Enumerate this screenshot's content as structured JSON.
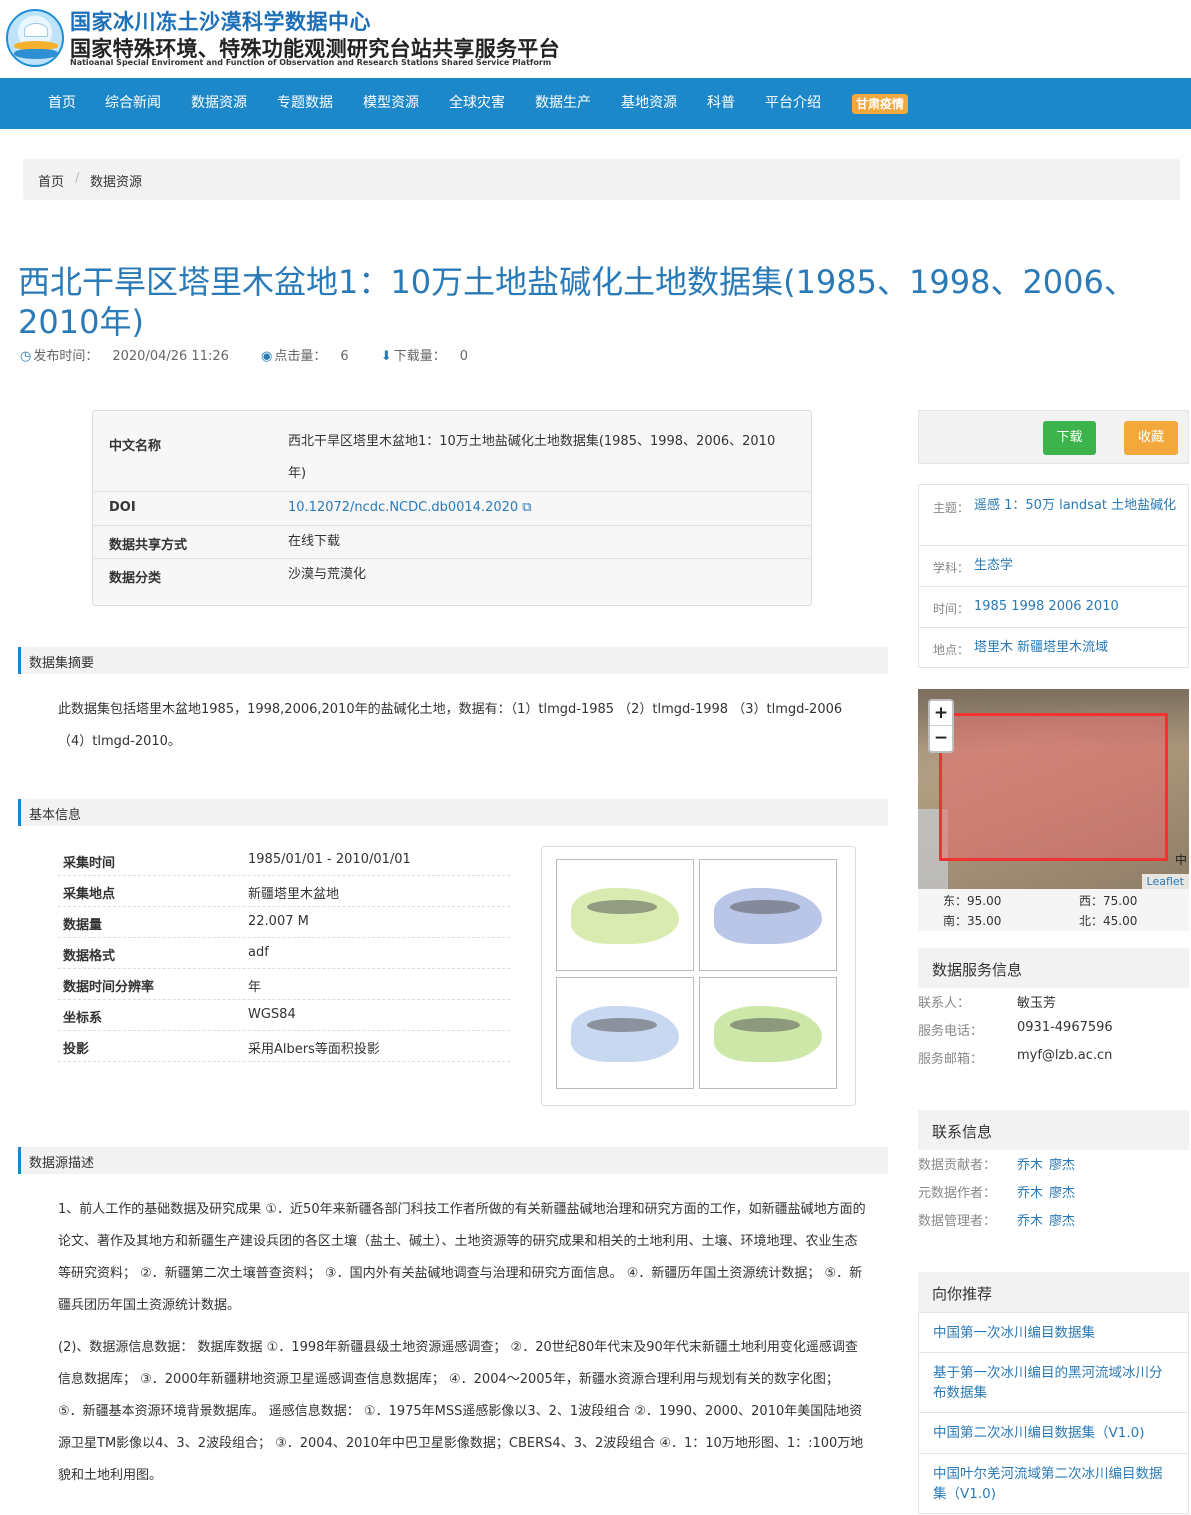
{
  "site": {
    "title_cn": "国家冰川冻土沙漠科学数据中心",
    "subtitle_cn": "国家特殊环境、特殊功能观测研究台站共享服务平台",
    "subtitle_en": "Natioanal Special Enviroment and Function of Observation and Research Stations Shared Service Platform"
  },
  "nav": {
    "items": [
      "首页",
      "综合新闻",
      "数据资源",
      "专题数据",
      "模型资源",
      "全球灾害",
      "数据生产",
      "基地资源",
      "科普",
      "平台介绍"
    ],
    "badge": "甘肃疫情"
  },
  "breadcrumb": {
    "home": "首页",
    "sep": "/",
    "current": "数据资源"
  },
  "dataset": {
    "title": "西北干旱区塔里木盆地1：10万土地盐碱化土地数据集(1985、1998、2006、2010年)",
    "publish_label": "发布时间：",
    "publish_time": "2020/04/26 11:26",
    "views_label": "点击量：",
    "views": "6",
    "downloads_label": "下载量：",
    "downloads": "0"
  },
  "info_box": {
    "rows": [
      {
        "label": "中文名称",
        "value": "西北干旱区塔里木盆地1：10万土地盐碱化土地数据集(1985、1998、2006、2010年)"
      },
      {
        "label": "DOI",
        "value": "10.12072/ncdc.NCDC.db0014.2020"
      },
      {
        "label": "数据共享方式",
        "value": "在线下载"
      },
      {
        "label": "数据分类",
        "value": "沙漠与荒漠化"
      }
    ]
  },
  "abstract": {
    "heading": "数据集摘要",
    "text": "此数据集包括塔里木盆地1985，1998,2006,2010年的盐碱化土地，数据有：（1）tlmgd-1985 （2）tlmgd-1998 （3）tlmgd-2006 （4）tlmgd-2010。"
  },
  "basic_info": {
    "heading": "基本信息",
    "rows": [
      {
        "label": "采集时间",
        "value": "1985/01/01  -  2010/01/01"
      },
      {
        "label": "采集地点",
        "value": "新疆塔里木盆地"
      },
      {
        "label": "数据量",
        "value": "22.007 M"
      },
      {
        "label": "数据格式",
        "value": "adf"
      },
      {
        "label": "数据时间分辨率",
        "value": "年"
      },
      {
        "label": "坐标系",
        "value": "WGS84"
      },
      {
        "label": "投影",
        "value": "采用Albers等面积投影"
      }
    ]
  },
  "source": {
    "heading": "数据源描述",
    "p1": "1、前人工作的基础数据及研究成果 ①．近50年来新疆各部门科技工作者所做的有关新疆盐碱地治理和研究方面的工作，如新疆盐碱地方面的论文、著作及其地方和新疆生产建设兵团的各区土壤（盐土、碱土）、土地资源等的研究成果和相关的土地利用、土壤、环境地理、农业生态等研究资料；  ②．新疆第二次土壤普查资料；  ③．国内外有关盐碱地调查与治理和研究方面信息。 ④．新疆历年国土资源统计数据；  ⑤．新疆兵团历年国土资源统计数据。",
    "p2": "(2)、数据源信息数据： 数据库数据 ①．1998年新疆县级土地资源遥感调查；  ②．20世纪80年代末及90年代末新疆土地利用变化遥感调查信息数据库；  ③．2000年新疆耕地资源卫星遥感调查信息数据库；  ④．2004～2005年，新疆水资源合理利用与规划有关的数字化图；  ⑤．新疆基本资源环境背景数据库。 遥感信息数据： ①．1975年MSS遥感影像以3、2、1波段组合 ②．1990、2000、2010年美国陆地资源卫星TM影像以4、3、2波段组合；  ③．2004、2010年中巴卫星影像数据；CBERS4、3、2波段组合 ④．1：10万地形图、1：:100万地貌和土地利用图。"
  },
  "sidebar": {
    "download": "下载",
    "favorite": "收藏",
    "keywords": [
      {
        "label": "主题：",
        "value": "遥感 1：50万 landsat 土地盐碱化"
      },
      {
        "label": "学科：",
        "value": "生态学"
      },
      {
        "label": "时间：",
        "value": "1985 1998 2006 2010"
      },
      {
        "label": "地点：",
        "value": "塔里木 新疆塔里木流域"
      }
    ],
    "map": {
      "zoom_in": "+",
      "zoom_out": "−",
      "attribution": "Leaflet",
      "corner_glyph": "中"
    },
    "coords": {
      "east": "东：95.00",
      "west": "西：75.00",
      "south": "南：35.00",
      "north": "北：45.00"
    },
    "service": {
      "heading": "数据服务信息",
      "rows": [
        {
          "label": "联系人：",
          "value": "敏玉芳"
        },
        {
          "label": "服务电话：",
          "value": "0931-4967596"
        },
        {
          "label": "服务邮箱：",
          "value": "myf@lzb.ac.cn"
        }
      ]
    },
    "contact": {
      "heading": "联系信息",
      "rows": [
        {
          "label": "数据贡献者：",
          "v1": "乔木",
          "v2": "廖杰"
        },
        {
          "label": "元数据作者：",
          "v1": "乔木",
          "v2": "廖杰"
        },
        {
          "label": "数据管理者：",
          "v1": "乔木",
          "v2": "廖杰"
        }
      ]
    },
    "recommend": {
      "heading": "向你推荐",
      "items": [
        "中国第一次冰川编目数据集",
        "基于第一次冰川编目的黑河流域冰川分布数据集",
        "中国第二次冰川编目数据集（V1.0)",
        "中国叶尔羌河流域第二次冰川编目数据集（V1.0)"
      ]
    }
  },
  "colors": {
    "brand": "#1d88c9",
    "link": "#2a7ab7",
    "download_btn": "#3cb44b",
    "favorite_btn": "#f2a83b"
  }
}
